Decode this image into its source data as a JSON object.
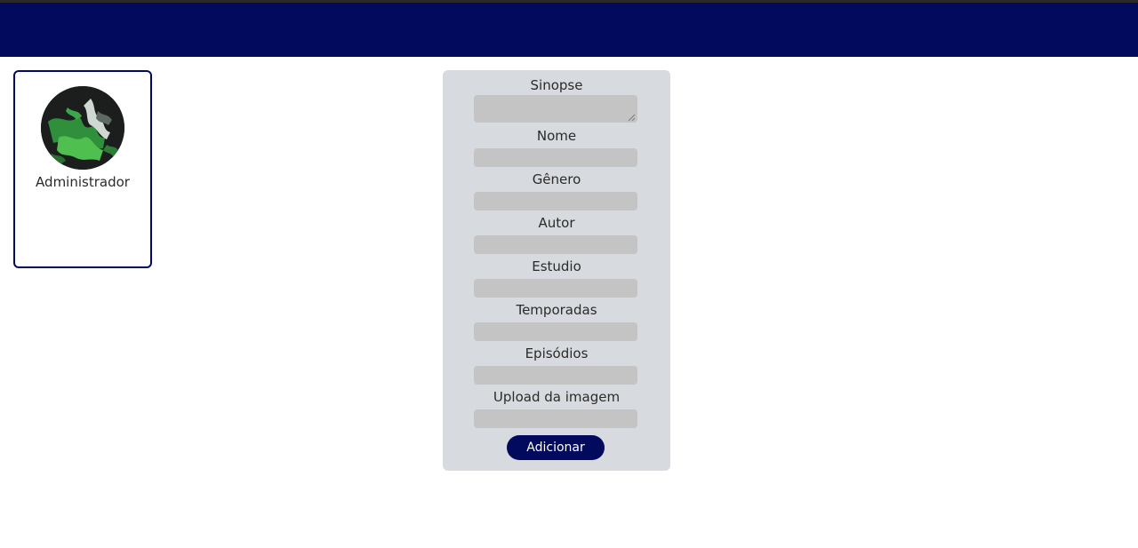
{
  "colors": {
    "header": "#020a5e",
    "panel": "#d7dade",
    "input": "#c4c4c4",
    "button": "#020a5e",
    "button_text": "#ffffff"
  },
  "profile": {
    "avatar_icon": "avatar-image",
    "name": "Administrador"
  },
  "form": {
    "fields": [
      {
        "label": "Sinopse",
        "value": "",
        "type": "textarea"
      },
      {
        "label": "Nome",
        "value": ""
      },
      {
        "label": "Gênero",
        "value": ""
      },
      {
        "label": "Autor",
        "value": ""
      },
      {
        "label": "Estudio",
        "value": ""
      },
      {
        "label": "Temporadas",
        "value": ""
      },
      {
        "label": "Episódios",
        "value": ""
      },
      {
        "label": "Upload da imagem",
        "value": ""
      }
    ],
    "submit_label": "Adicionar"
  }
}
